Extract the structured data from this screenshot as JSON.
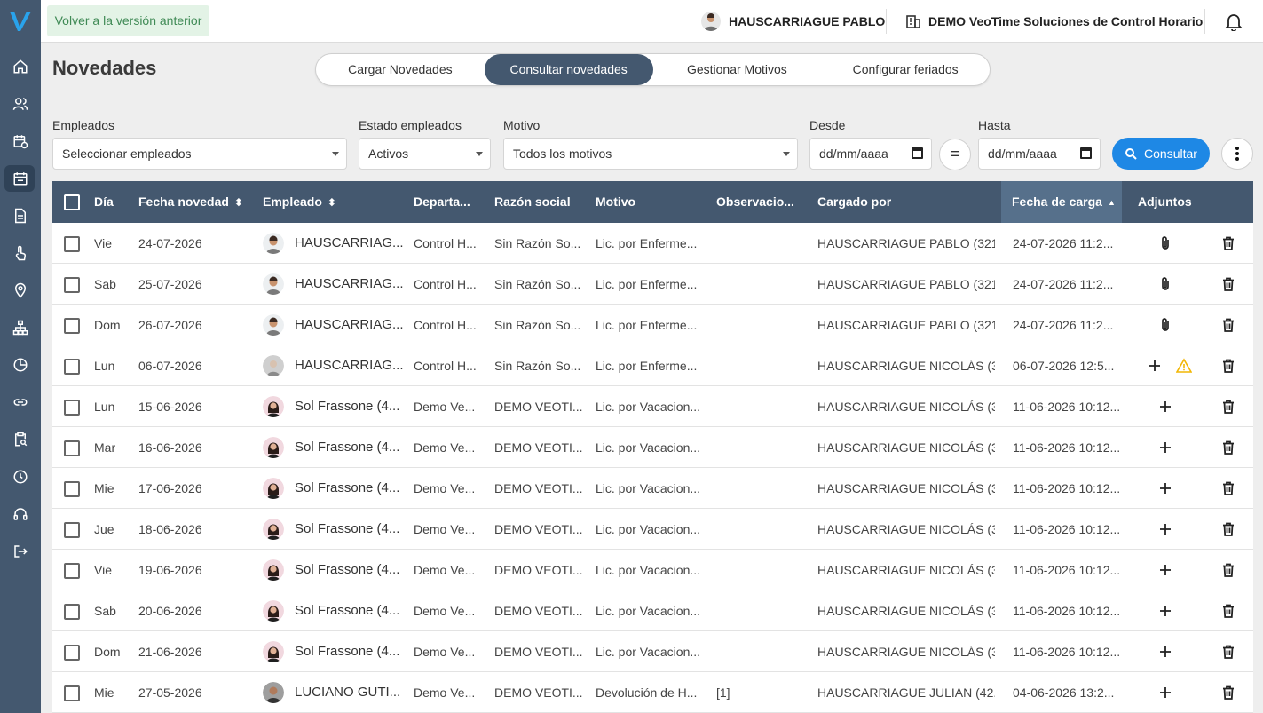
{
  "colors": {
    "sidebar": "#44586f",
    "header": "#44586f",
    "accent": "#1e88e5",
    "back_bg": "#e3f3e6",
    "warning": "#f2b705"
  },
  "sidebar": {
    "icons": [
      "home-icon",
      "users-icon",
      "calendar-clock-icon",
      "calendar-icon",
      "document-icon",
      "touch-icon",
      "location-icon",
      "org-chart-icon",
      "pie-chart-icon",
      "link-icon",
      "clipboard-search-icon",
      "clock-icon",
      "support-icon",
      "logout-icon"
    ]
  },
  "topbar": {
    "back_label": "Volver a la versión anterior",
    "user_name": "HAUSCARRIAGUE PABLO",
    "company_name": "DEMO VeoTime Soluciones de Control Horario"
  },
  "page": {
    "title": "Novedades"
  },
  "tabs": [
    {
      "label": "Cargar Novedades",
      "active": false
    },
    {
      "label": "Consultar novedades",
      "active": true
    },
    {
      "label": "Gestionar Motivos",
      "active": false
    },
    {
      "label": "Configurar feriados",
      "active": false
    }
  ],
  "filters": {
    "empleados": {
      "label": "Empleados",
      "value": "Seleccionar empleados"
    },
    "estado": {
      "label": "Estado empleados",
      "value": "Activos"
    },
    "motivo": {
      "label": "Motivo",
      "value": "Todos los motivos"
    },
    "desde": {
      "label": "Desde",
      "value": "dd/mm/aaaa"
    },
    "hasta": {
      "label": "Hasta",
      "value": "dd/mm/aaaa"
    },
    "equal_label": "=",
    "consult_label": "Consultar"
  },
  "table": {
    "headers": {
      "dia": "Día",
      "fecha_novedad": "Fecha novedad",
      "empleado": "Empleado",
      "departamento": "Departa...",
      "razon_social": "Razón social",
      "motivo": "Motivo",
      "observaciones": "Observacio...",
      "cargado_por": "Cargado por",
      "fecha_carga": "Fecha de carga",
      "adjuntos": "Adjuntos"
    },
    "rows": [
      {
        "dia": "Vie",
        "fecha": "24-07-2026",
        "empleado": "HAUSCARRIAG...",
        "avatar": "man",
        "depto": "Control H...",
        "razon": "Sin Razón So...",
        "motivo": "Lic. por Enferme...",
        "obs": "",
        "cargado": "HAUSCARRIAGUE PABLO (321...",
        "fecha_carga": "24-07-2026 11:2...",
        "adjunto": "clip"
      },
      {
        "dia": "Sab",
        "fecha": "25-07-2026",
        "empleado": "HAUSCARRIAG...",
        "avatar": "man",
        "depto": "Control H...",
        "razon": "Sin Razón So...",
        "motivo": "Lic. por Enferme...",
        "obs": "",
        "cargado": "HAUSCARRIAGUE PABLO (321...",
        "fecha_carga": "24-07-2026 11:2...",
        "adjunto": "clip"
      },
      {
        "dia": "Dom",
        "fecha": "26-07-2026",
        "empleado": "HAUSCARRIAG...",
        "avatar": "man",
        "depto": "Control H...",
        "razon": "Sin Razón So...",
        "motivo": "Lic. por Enferme...",
        "obs": "",
        "cargado": "HAUSCARRIAGUE PABLO (321...",
        "fecha_carga": "24-07-2026 11:2...",
        "adjunto": "clip"
      },
      {
        "dia": "Lun",
        "fecha": "06-07-2026",
        "empleado": "HAUSCARRIAG...",
        "avatar": "gray",
        "depto": "Control H...",
        "razon": "Sin Razón So...",
        "motivo": "Lic. por Enferme...",
        "obs": "",
        "cargado": "HAUSCARRIAGUE NICOLÁS (3...",
        "fecha_carga": "06-07-2026 12:5...",
        "adjunto": "plus-warning"
      },
      {
        "dia": "Lun",
        "fecha": "15-06-2026",
        "empleado": "Sol Frassone (4...",
        "avatar": "woman",
        "depto": "Demo Ve...",
        "razon": "DEMO VEOTI...",
        "motivo": "Lic. por Vacacion...",
        "obs": "",
        "cargado": "HAUSCARRIAGUE NICOLÁS (3...",
        "fecha_carga": "11-06-2026 10:12...",
        "adjunto": "plus"
      },
      {
        "dia": "Mar",
        "fecha": "16-06-2026",
        "empleado": "Sol Frassone (4...",
        "avatar": "woman",
        "depto": "Demo Ve...",
        "razon": "DEMO VEOTI...",
        "motivo": "Lic. por Vacacion...",
        "obs": "",
        "cargado": "HAUSCARRIAGUE NICOLÁS (3...",
        "fecha_carga": "11-06-2026 10:12...",
        "adjunto": "plus"
      },
      {
        "dia": "Mie",
        "fecha": "17-06-2026",
        "empleado": "Sol Frassone (4...",
        "avatar": "woman",
        "depto": "Demo Ve...",
        "razon": "DEMO VEOTI...",
        "motivo": "Lic. por Vacacion...",
        "obs": "",
        "cargado": "HAUSCARRIAGUE NICOLÁS (3...",
        "fecha_carga": "11-06-2026 10:12...",
        "adjunto": "plus"
      },
      {
        "dia": "Jue",
        "fecha": "18-06-2026",
        "empleado": "Sol Frassone (4...",
        "avatar": "woman",
        "depto": "Demo Ve...",
        "razon": "DEMO VEOTI...",
        "motivo": "Lic. por Vacacion...",
        "obs": "",
        "cargado": "HAUSCARRIAGUE NICOLÁS (3...",
        "fecha_carga": "11-06-2026 10:12...",
        "adjunto": "plus"
      },
      {
        "dia": "Vie",
        "fecha": "19-06-2026",
        "empleado": "Sol Frassone (4...",
        "avatar": "woman",
        "depto": "Demo Ve...",
        "razon": "DEMO VEOTI...",
        "motivo": "Lic. por Vacacion...",
        "obs": "",
        "cargado": "HAUSCARRIAGUE NICOLÁS (3...",
        "fecha_carga": "11-06-2026 10:12...",
        "adjunto": "plus"
      },
      {
        "dia": "Sab",
        "fecha": "20-06-2026",
        "empleado": "Sol Frassone (4...",
        "avatar": "woman",
        "depto": "Demo Ve...",
        "razon": "DEMO VEOTI...",
        "motivo": "Lic. por Vacacion...",
        "obs": "",
        "cargado": "HAUSCARRIAGUE NICOLÁS (3...",
        "fecha_carga": "11-06-2026 10:12...",
        "adjunto": "plus"
      },
      {
        "dia": "Dom",
        "fecha": "21-06-2026",
        "empleado": "Sol Frassone (4...",
        "avatar": "woman",
        "depto": "Demo Ve...",
        "razon": "DEMO VEOTI...",
        "motivo": "Lic. por Vacacion...",
        "obs": "",
        "cargado": "HAUSCARRIAGUE NICOLÁS (3...",
        "fecha_carga": "11-06-2026 10:12...",
        "adjunto": "plus"
      },
      {
        "dia": "Mie",
        "fecha": "27-05-2026",
        "empleado": "LUCIANO GUTI...",
        "avatar": "man2",
        "depto": "Demo Ve...",
        "razon": "DEMO VEOTI...",
        "motivo": "Devolución de H...",
        "obs": "[1]",
        "cargado": "HAUSCARRIAGUE JULIAN (42...",
        "fecha_carga": "04-06-2026 13:2...",
        "adjunto": "plus"
      }
    ]
  }
}
